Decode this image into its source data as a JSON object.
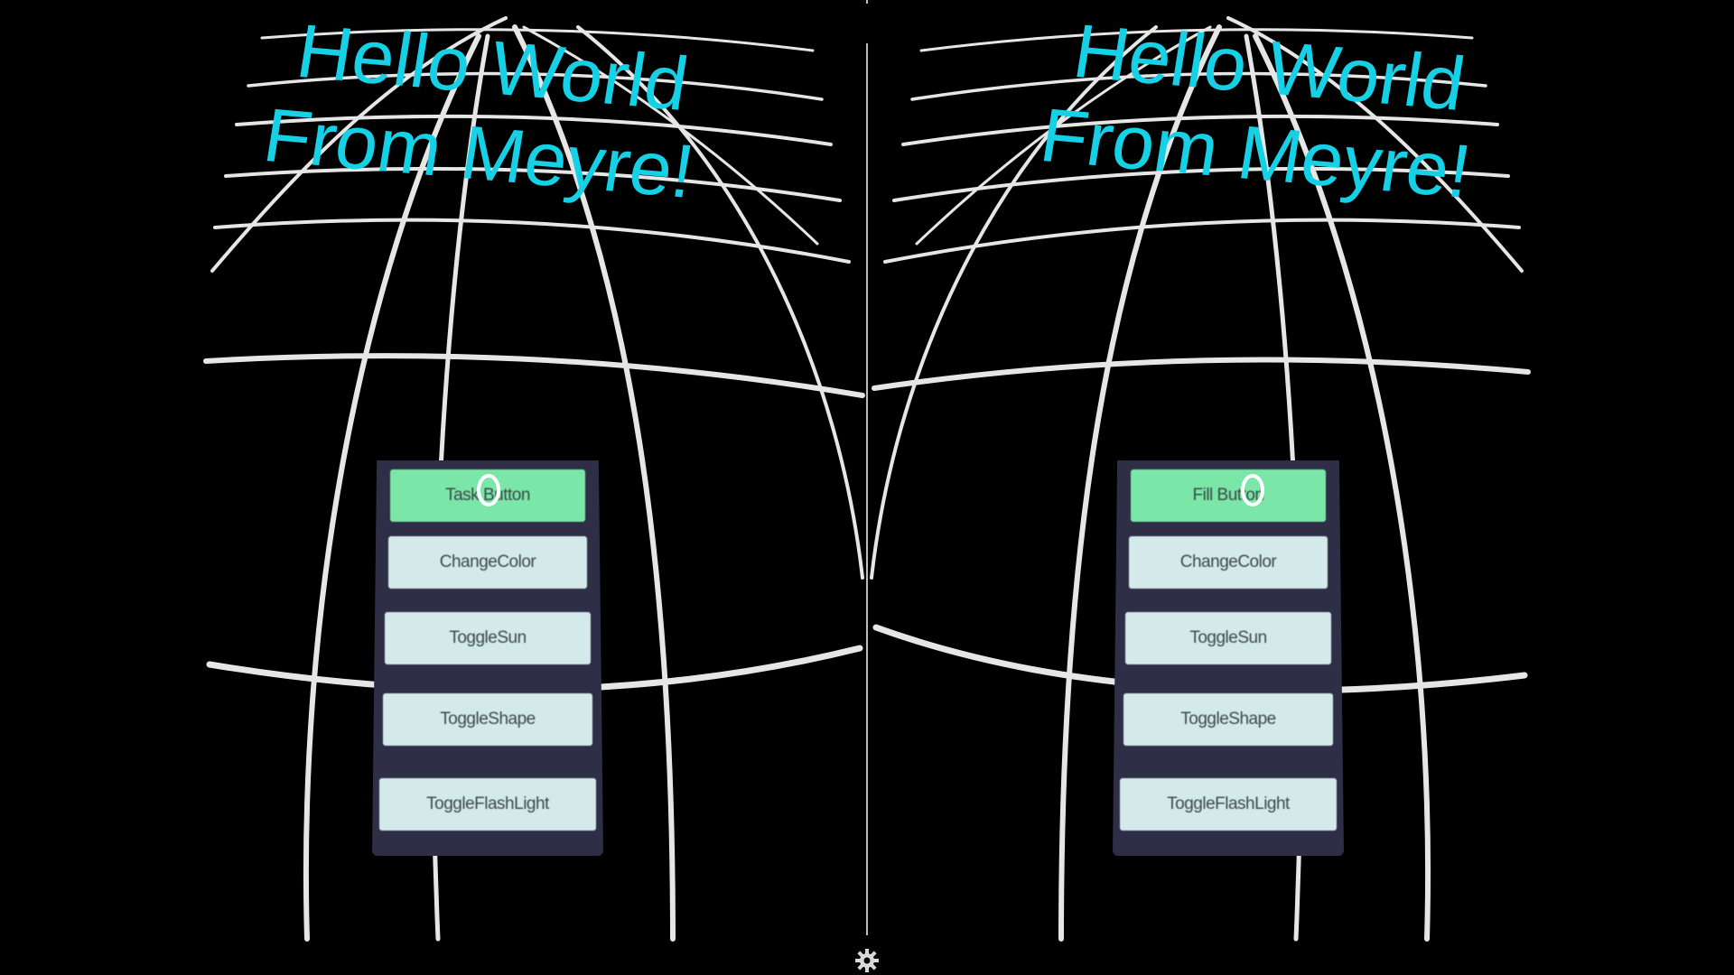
{
  "scene": {
    "greeting_line_1": "Hello World",
    "greeting_line_2": "From Meyre!",
    "greeting_color": "#16d0e6",
    "menu": {
      "panel_color": "#2e2f47",
      "button_color": "#d4eaea",
      "highlight_color": "#7ae6a8",
      "left_eye_buttons": [
        "Task Button",
        "ChangeColor",
        "ToggleSun",
        "ToggleShape",
        "ToggleFlashLight"
      ],
      "right_eye_buttons": [
        "Fill Button",
        "ChangeColor",
        "ToggleSun",
        "ToggleShape",
        "ToggleFlashLight"
      ]
    },
    "grid_color": "#e6e6e6"
  },
  "icons": {
    "gaze_reticle": "circle-reticle-icon",
    "settings": "gear-icon"
  }
}
